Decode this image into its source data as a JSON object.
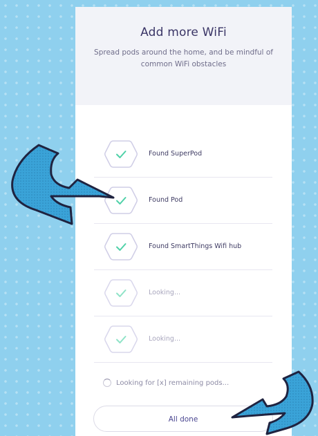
{
  "header": {
    "title": "Add more WiFi",
    "subtitle": "Spread pods around the home, and be mindful of common WiFi obstacles"
  },
  "pods": [
    {
      "label": "Found SuperPod",
      "state": "found"
    },
    {
      "label": "Found Pod",
      "state": "found"
    },
    {
      "label": "Found SmartThings Wifi hub",
      "state": "found"
    },
    {
      "label": "Looking...",
      "state": "looking"
    },
    {
      "label": "Looking...",
      "state": "looking"
    }
  ],
  "status_text": "Looking for [x] remaining pods...",
  "done_label": "All done",
  "colors": {
    "background": "#8fd0ee",
    "check": "#4fd1a8",
    "hex_outline": "#cfcde6",
    "arrow_fill": "#3aa3d8",
    "arrow_outline": "#1f2340"
  }
}
